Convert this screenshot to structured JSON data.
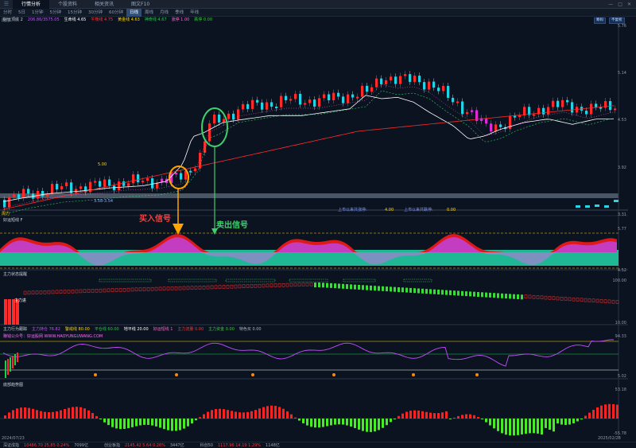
{
  "topbar": {
    "tabs": [
      "行情分析",
      "个股资料",
      "相关资讯",
      "图文F10"
    ],
    "active_tab": 0,
    "window_buttons": [
      "—",
      "□",
      "✕"
    ]
  },
  "periodbar": {
    "periods": [
      "分时",
      "5日",
      "1分钟",
      "5分钟",
      "15分钟",
      "30分钟",
      "60分钟",
      "日线",
      "周线",
      "月线",
      "季线",
      "年线"
    ],
    "active": 7
  },
  "main_panel": {
    "corner_label": "周力",
    "indicator_name": "好运顶底 2",
    "items": [
      {
        "text": "206.86/3575.05",
        "color": "#c44dff"
      },
      {
        "text": "生命线 4.65",
        "color": "#ffffff"
      },
      {
        "text": "牛熊线 4.75",
        "color": "#ff3333"
      },
      {
        "text": "黄金线 4.63",
        "color": "#ffd700"
      },
      {
        "text": "神奇线 4.67",
        "color": "#22cc44"
      },
      {
        "text": "涨停 1.00",
        "color": "#ff66cc"
      },
      {
        "text": "跌停 0.00",
        "color": "#33cc33"
      }
    ],
    "right_buttons": [
      "筹码",
      "不复权"
    ],
    "price_labels": [
      "5.76",
      "5.14",
      "4.53",
      "3.92",
      "3.31"
    ],
    "price_marks": [
      "5.00",
      "3.58-3.54"
    ],
    "info_left": "上市以来共涨停:",
    "info_left_val": "4.00",
    "info_right": "上市以来共跌停:",
    "info_right_val": "0.00",
    "bottom_corner": "周力"
  },
  "annotations": {
    "buy": "买入信号",
    "sell": "卖出信号"
  },
  "panel2": {
    "title": "好运短线 F",
    "right_labels": [
      "5.77",
      "4.52"
    ]
  },
  "panel3": {
    "title": "主力状态提醒",
    "mark": "主力进",
    "right_labels": [
      "100.00",
      "10.00"
    ]
  },
  "panel4": {
    "title": "主力行为跟踪",
    "items": [
      {
        "text": "主力持仓 76.82",
        "color": "#c44dff"
      },
      {
        "text": "警戒线 80.00",
        "color": "#ffd700"
      },
      {
        "text": "平仓线 60.00",
        "color": "#22cc44"
      },
      {
        "text": "地平线 20.00",
        "color": "#ffffff"
      },
      {
        "text": "好运短线 1",
        "color": "#ff66cc"
      },
      {
        "text": "主力流量 0.00",
        "color": "#ff3333"
      },
      {
        "text": "主力资金 0.00",
        "color": "#33cc33"
      },
      {
        "text": "特色买 0.00",
        "color": "#aab4c4"
      }
    ],
    "website": "赚钱公众号：好运股网 WWW.HAOYUNGUWANG.COM",
    "right_labels": [
      "94.33",
      "5.02"
    ]
  },
  "panel5": {
    "title": "底部趋势图",
    "right_labels": [
      "53.18",
      "-55.78"
    ]
  },
  "dates": {
    "left": "2024/07/23",
    "right": "2025/02/28"
  },
  "statusbar": [
    {
      "text": "深证成指",
      "color": "#9aa8bb"
    },
    {
      "text": "10486.70  25.85  0.24%",
      "color": "#ff3333"
    },
    {
      "text": "7099亿",
      "color": "#9aa8bb"
    },
    {
      "text": "创业板指",
      "color": "#9aa8bb"
    },
    {
      "text": "2145.42  5.64  0.26%",
      "color": "#ff3333"
    },
    {
      "text": "3447亿",
      "color": "#9aa8bb"
    },
    {
      "text": "科创50",
      "color": "#9aa8bb"
    },
    {
      "text": "1117.96  14.19  1.29%",
      "color": "#ff3333"
    },
    {
      "text": "1148亿",
      "color": "#9aa8bb"
    }
  ],
  "colors": {
    "up": "#ff2a2a",
    "down": "#22d3e6",
    "magenta": "#e02ad8",
    "green": "#33e033",
    "teal": "#1fb894",
    "purple": "#8e88c8",
    "yellow": "#ffd700"
  }
}
